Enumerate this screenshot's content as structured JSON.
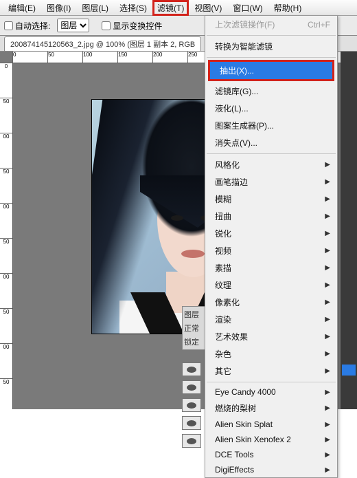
{
  "menubar": {
    "items": [
      {
        "label": "编辑(E)"
      },
      {
        "label": "图像(I)"
      },
      {
        "label": "图层(L)"
      },
      {
        "label": "选择(S)"
      },
      {
        "label": "滤镜(T)",
        "boxed": true
      },
      {
        "label": "视图(V)"
      },
      {
        "label": "窗口(W)"
      },
      {
        "label": "帮助(H)"
      }
    ]
  },
  "optbar": {
    "auto_select_label": "自动选择:",
    "layer_select": "图层",
    "transform_label": "显示变换控件"
  },
  "tab": {
    "title": "200874145120563_2.jpg @ 100% (图层 1 副本 2, RGB"
  },
  "ruler_top": [
    "0",
    "50",
    "100",
    "150",
    "200",
    "250"
  ],
  "ruler_left": [
    "0",
    "50",
    "00",
    "50",
    "00",
    "50",
    "00",
    "50",
    "00",
    "50"
  ],
  "dropdown": {
    "last": {
      "label": "上次滤镜操作(F)",
      "accel": "Ctrl+F"
    },
    "smart": "转换为智能滤镜",
    "highlight": "抽出(X)...",
    "group1": [
      "滤镜库(G)...",
      "液化(L)...",
      "图案生成器(P)...",
      "消失点(V)..."
    ],
    "group2": [
      "风格化",
      "画笔描边",
      "模糊",
      "扭曲",
      "锐化",
      "视频",
      "素描",
      "纹理",
      "像素化",
      "渲染",
      "艺术效果",
      "杂色",
      "其它"
    ],
    "group3": [
      "Eye Candy 4000",
      "燃烧的梨树",
      "Alien Skin Splat",
      "Alien Skin Xenofex 2",
      "DCE Tools",
      "DigiEffects"
    ]
  },
  "layerspanel": {
    "a": "图层",
    "b": "正常",
    "c": "锁定"
  }
}
